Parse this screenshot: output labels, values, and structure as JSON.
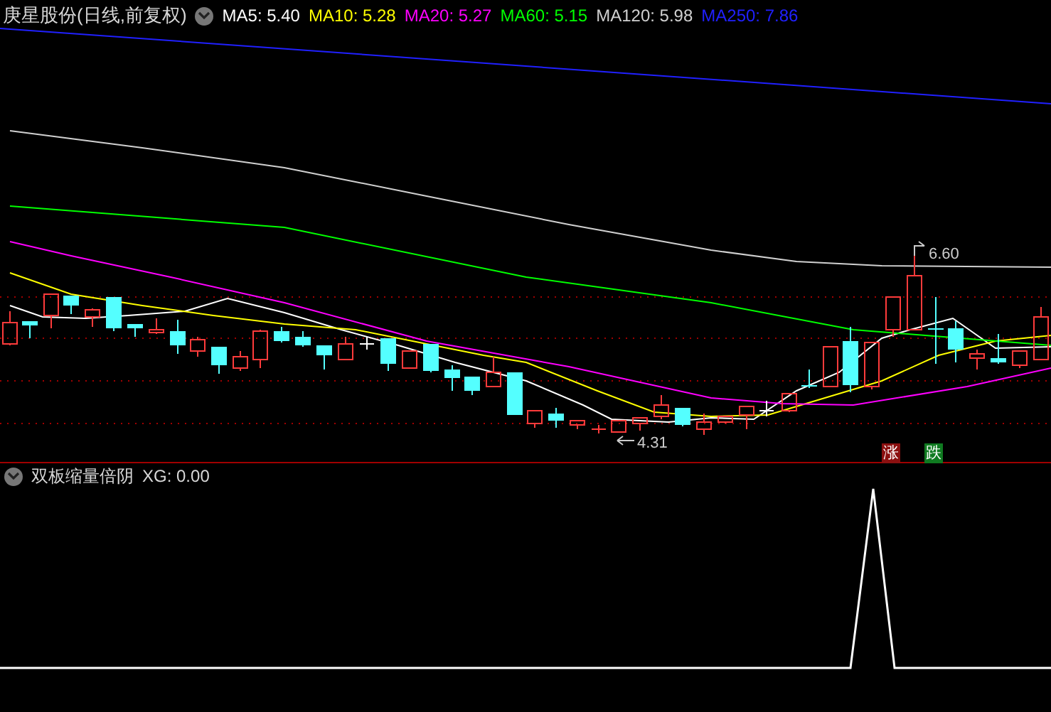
{
  "main_panel": {
    "title": "庚星股份(日线,前复权)",
    "legend": [
      {
        "text": "MA5: 5.40",
        "color": "#ffffff"
      },
      {
        "text": "MA10: 5.28",
        "color": "#ffff00"
      },
      {
        "text": "MA20: 5.27",
        "color": "#ff00ff"
      },
      {
        "text": "MA60: 5.15",
        "color": "#00ff00"
      },
      {
        "text": "MA120: 5.98",
        "color": "#d0d0d0"
      },
      {
        "text": "MA250: 7.86",
        "color": "#2020ff"
      }
    ],
    "high_marker": "6.60",
    "low_marker": "4.31",
    "signals": [
      {
        "kind": "rise",
        "text": "涨"
      },
      {
        "kind": "fall",
        "text": "跌"
      }
    ]
  },
  "indicator_panel": {
    "title": "双板缩量倍阴",
    "reading": "XG: 0.00"
  }
}
